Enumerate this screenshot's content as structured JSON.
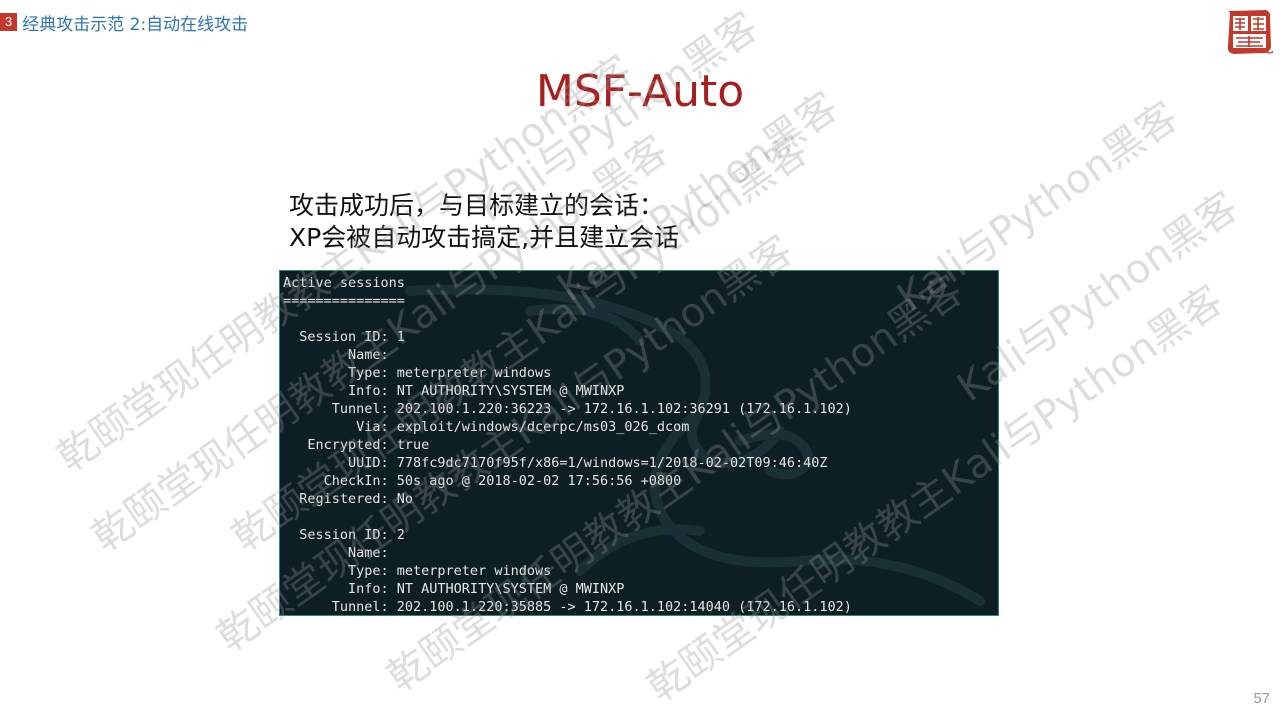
{
  "header": {
    "section_number": "3",
    "section_title": "经典攻击示范 2:自动在线攻击"
  },
  "logo": {
    "alt": "乾颐堂 seal",
    "chars": "颐乾堂"
  },
  "slide": {
    "title": "MSF-Auto",
    "caption_line1": "攻击成功后，与目标建立的会话：",
    "caption_line2": "XP会被自动攻击搞定,并且建立会话"
  },
  "terminal": {
    "lines": [
      "Active sessions",
      "===============",
      "",
      "  Session ID: 1",
      "        Name:",
      "        Type: meterpreter windows",
      "        Info: NT AUTHORITY\\SYSTEM @ MWINXP",
      "      Tunnel: 202.100.1.220:36223 -> 172.16.1.102:36291 (172.16.1.102)",
      "         Via: exploit/windows/dcerpc/ms03_026_dcom",
      "   Encrypted: true",
      "        UUID: 778fc9dc7170f95f/x86=1/windows=1/2018-02-02T09:46:40Z",
      "     CheckIn: 50s ago @ 2018-02-02 17:56:56 +0800",
      "  Registered: No",
      "",
      "  Session ID: 2",
      "        Name:",
      "        Type: meterpreter windows",
      "        Info: NT AUTHORITY\\SYSTEM @ MWINXP",
      "      Tunnel: 202.100.1.220:35885 -> 172.16.1.102:14040 (172.16.1.102)"
    ]
  },
  "watermark": {
    "text_a": "乾颐堂现任明教教主Kali与Python黑客",
    "text_b": "Kali与Python黑客"
  },
  "page_number": "57",
  "colors": {
    "title": "#a61e1e",
    "section_badge": "#c0392b",
    "section_text": "#2e74b5",
    "terminal_bg": "#0e1e25",
    "terminal_border": "#2b8c6a"
  }
}
